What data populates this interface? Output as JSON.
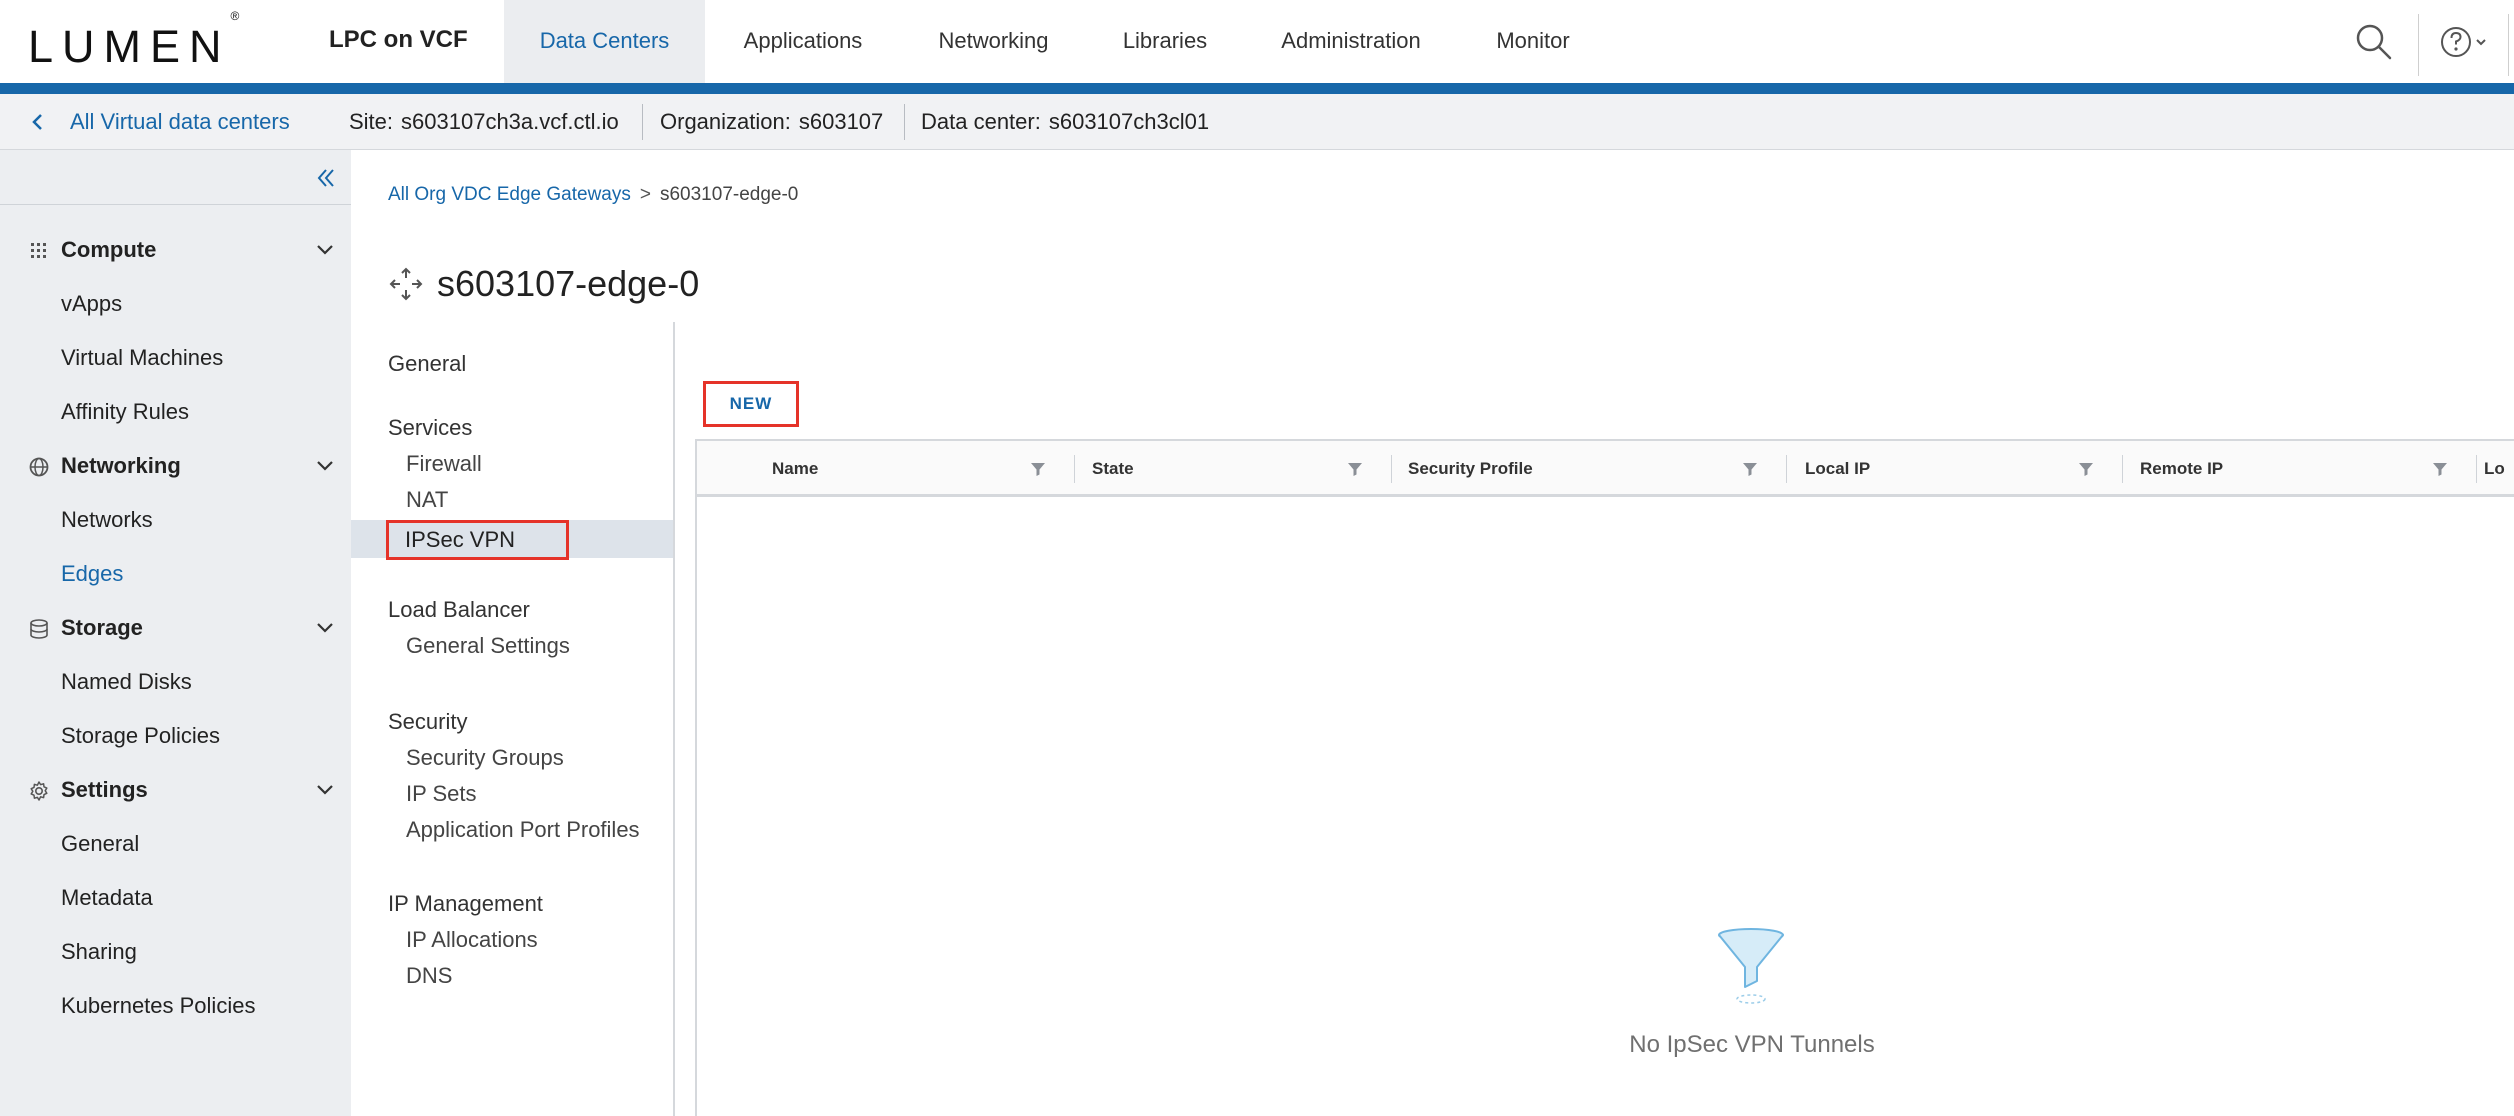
{
  "header": {
    "logo_text": "LUMEN",
    "logo_mark": "®",
    "product_name": "LPC on VCF",
    "nav": [
      {
        "label": "Data Centers",
        "active": true
      },
      {
        "label": "Applications",
        "active": false
      },
      {
        "label": "Networking",
        "active": false
      },
      {
        "label": "Libraries",
        "active": false
      },
      {
        "label": "Administration",
        "active": false
      },
      {
        "label": "Monitor",
        "active": false
      }
    ],
    "icons": [
      "search-icon",
      "help-icon",
      "chevron-down-icon"
    ]
  },
  "context": {
    "back_label": "All Virtual data centers",
    "site_label": "Site:",
    "site_value": "s603107ch3a.vcf.ctl.io",
    "org_label": "Organization:",
    "org_value": "s603107",
    "dc_label": "Data center:",
    "dc_value": "s603107ch3cl01"
  },
  "sidebar": {
    "groups": [
      {
        "label": "Compute",
        "icon": "grid-icon",
        "items": [
          "vApps",
          "Virtual Machines",
          "Affinity Rules"
        ]
      },
      {
        "label": "Networking",
        "icon": "globe-icon",
        "items": [
          "Networks",
          "Edges"
        ]
      },
      {
        "label": "Storage",
        "icon": "database-icon",
        "items": [
          "Named Disks",
          "Storage Policies"
        ]
      },
      {
        "label": "Settings",
        "icon": "gear-icon",
        "items": [
          "General",
          "Metadata",
          "Sharing",
          "Kubernetes Policies"
        ]
      }
    ],
    "active_item": "Edges"
  },
  "breadcrumb": {
    "link": "All Org VDC Edge Gateways",
    "separator": ">",
    "current": "s603107-edge-0"
  },
  "page": {
    "title": "s603107-edge-0"
  },
  "subnav": {
    "general": "General",
    "services": "Services",
    "firewall": "Firewall",
    "nat": "NAT",
    "ipsec": "IPSec VPN",
    "load_balancer": "Load Balancer",
    "general_settings": "General Settings",
    "security": "Security",
    "security_groups": "Security Groups",
    "ip_sets": "IP Sets",
    "app_port_profiles": "Application Port Profiles",
    "ip_management": "IP Management",
    "ip_allocations": "IP Allocations",
    "dns": "DNS"
  },
  "toolbar": {
    "new_label": "NEW"
  },
  "grid": {
    "columns": [
      "Name",
      "State",
      "Security Profile",
      "Local IP",
      "Remote IP",
      "Lo"
    ],
    "empty_text": "No IpSec VPN Tunnels"
  },
  "colors": {
    "accent": "#1767a9",
    "highlight_box": "#e53329",
    "sidebar_bg": "#eceef1"
  }
}
